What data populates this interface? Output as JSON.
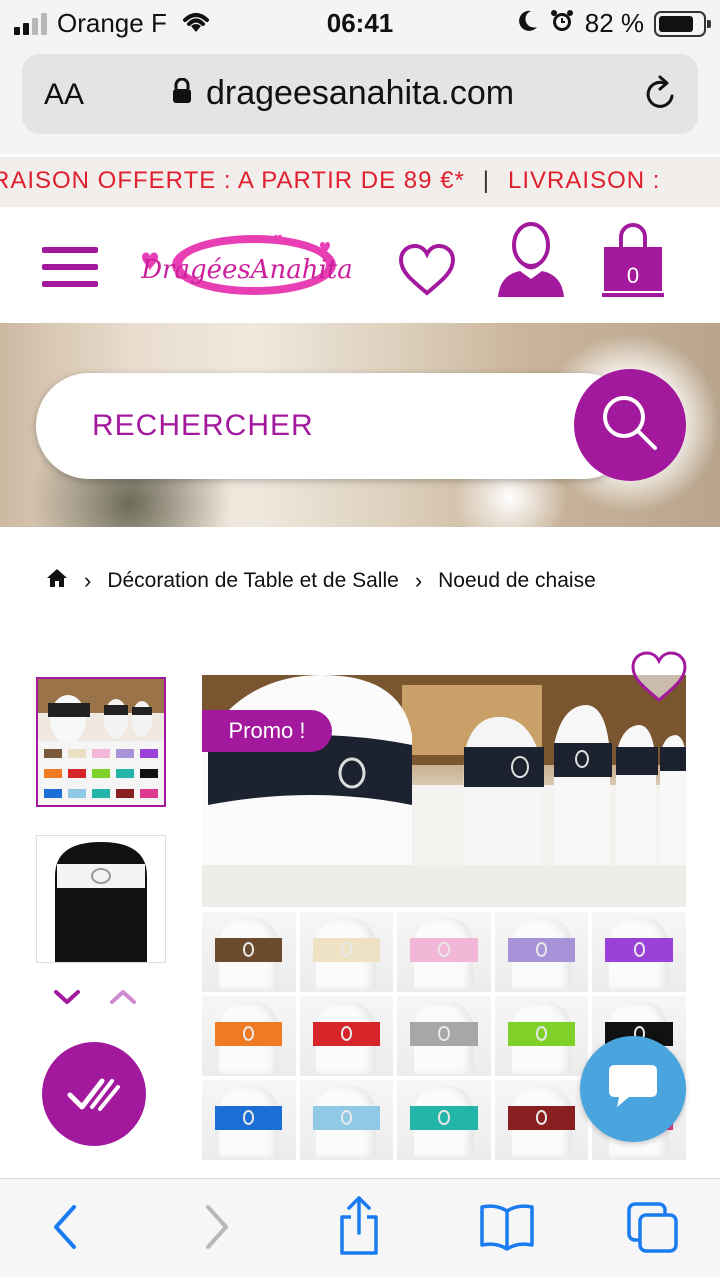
{
  "status_bar": {
    "carrier": "Orange F",
    "time": "06:41",
    "battery_pct": "82 %",
    "icons": [
      "signal-icon",
      "wifi-icon",
      "moon-icon",
      "alarm-icon",
      "battery-icon"
    ]
  },
  "browser": {
    "text_size_label": "AA",
    "url": "drageesanahita.com",
    "icons": [
      "lock-icon",
      "reload-icon"
    ]
  },
  "promo_banner": {
    "text_1": "RAISON OFFERTE : A PARTIR DE 89 €*",
    "separator": "|",
    "text_2": "LIVRAISON :"
  },
  "header": {
    "logo_text": "DragéesAnahita",
    "cart_count": "0",
    "icons": [
      "menu-icon",
      "heart-icon",
      "user-icon",
      "shopping-bag-icon"
    ]
  },
  "search": {
    "placeholder": "RECHERCHER",
    "icon": "search-icon"
  },
  "breadcrumb": {
    "home_icon": "home-icon",
    "items": [
      "Décoration de Table et de Salle",
      "Noeud de chaise"
    ]
  },
  "product": {
    "promo_badge": "Promo !",
    "swatches": [
      {
        "color": "#6b4a2e"
      },
      {
        "color": "#efe2c4"
      },
      {
        "color": "#f2b6d6"
      },
      {
        "color": "#a892d8"
      },
      {
        "color": "#9a42d8"
      },
      {
        "color": "#f07a22"
      },
      {
        "color": "#d6262a"
      },
      {
        "color": "#a7a7a7"
      },
      {
        "color": "#7fd12a"
      },
      {
        "color": "#111111"
      },
      {
        "color": "#1b6ed6"
      },
      {
        "color": "#8fc9e6"
      },
      {
        "color": "#22b5a8"
      },
      {
        "color": "#8a1f22"
      },
      {
        "color": "#e03a8e"
      }
    ]
  },
  "toolbar": {
    "icons": [
      "back-icon",
      "forward-icon",
      "share-icon",
      "bookmarks-icon",
      "tabs-icon"
    ]
  },
  "colors": {
    "brand": "#a3199e",
    "promo_red": "#e0202e",
    "chat_blue": "#4aa4de"
  }
}
